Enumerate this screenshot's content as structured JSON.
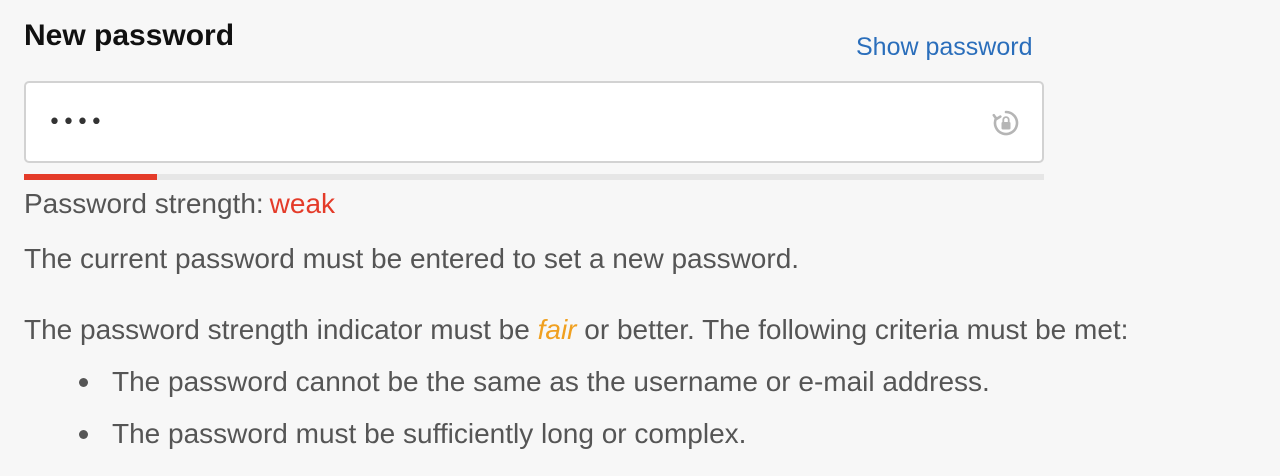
{
  "field": {
    "label": "New password",
    "show_password_link": "Show password",
    "value": "••••",
    "icon": "password-manager-key-icon"
  },
  "strength": {
    "label": "Password strength:",
    "value": "weak",
    "level": 0.13,
    "color": "#e43b29"
  },
  "notice": "The current password must be entered to set a new password.",
  "criteria": {
    "intro_before": "The password strength indicator must be",
    "intro_level": "fair",
    "intro_after": "or better. The following criteria must be met:",
    "items": [
      "The password cannot be the same as the username or e-mail address.",
      "The password must be sufficiently long or complex."
    ]
  },
  "colors": {
    "link": "#2a6ebb",
    "weak": "#e43b29",
    "fair": "#f0a020"
  }
}
